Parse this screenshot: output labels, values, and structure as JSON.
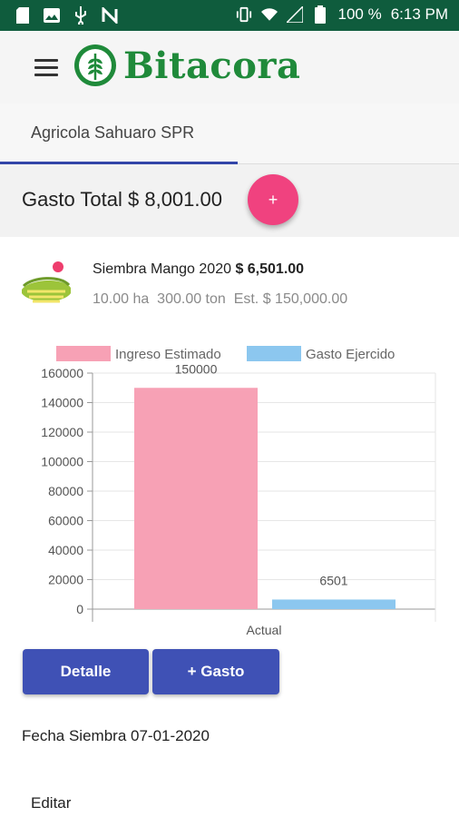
{
  "status_bar": {
    "battery": "100 %",
    "time": "6:13 PM"
  },
  "app": {
    "title": "Bitacora",
    "brand_color": "#1f8a3a"
  },
  "tabs": [
    {
      "label": "Agricola Sahuaro SPR",
      "selected": true
    }
  ],
  "summary": {
    "total_label": "Gasto Total $ 8,001.00",
    "fab_label": "+"
  },
  "crop": {
    "name": "Siembra Mango 2020",
    "amount": "$ 6,501.00",
    "meta": "10.00 ha  300.00 ton  Est. $ 150,000.00"
  },
  "chart_data": {
    "type": "bar",
    "categories": [
      "Actual"
    ],
    "series": [
      {
        "name": "Ingreso Estimado",
        "values": [
          150000
        ],
        "color": "#f7a1b5"
      },
      {
        "name": "Gasto Ejercido",
        "values": [
          6501
        ],
        "color": "#8cc7ef"
      }
    ],
    "ylim": [
      0,
      160000
    ],
    "yticks": [
      0,
      20000,
      40000,
      60000,
      80000,
      100000,
      120000,
      140000,
      160000
    ],
    "grid": true,
    "legend": "top",
    "data_labels": [
      "150000",
      "6501"
    ]
  },
  "buttons": {
    "detalle": "Detalle",
    "add_gasto": "+ Gasto"
  },
  "fecha": "Fecha Siembra 07-01-2020",
  "editar": "Editar"
}
